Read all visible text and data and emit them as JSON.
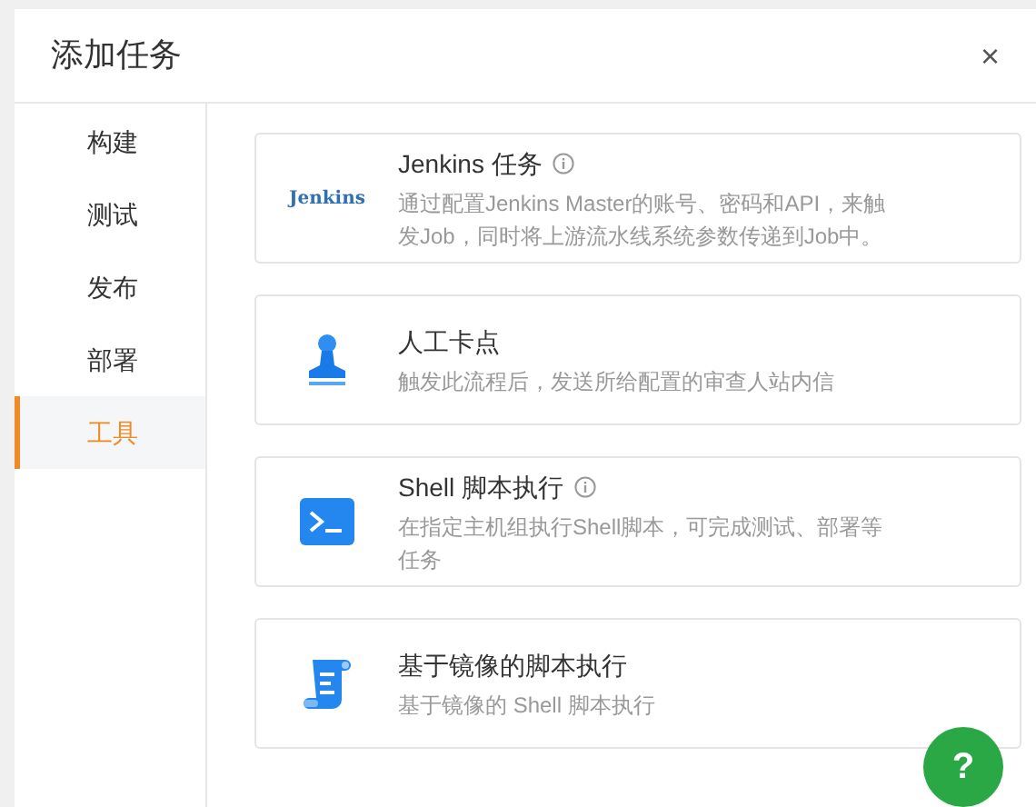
{
  "dialog": {
    "title": "添加任务",
    "close": "×"
  },
  "sidebar": {
    "items": [
      {
        "label": "构建",
        "selected": false
      },
      {
        "label": "测试",
        "selected": false
      },
      {
        "label": "发布",
        "selected": false
      },
      {
        "label": "部署",
        "selected": false
      },
      {
        "label": "工具",
        "selected": true
      }
    ]
  },
  "tasks": [
    {
      "kind": "logo",
      "logo_text": "Jenkins",
      "title": "Jenkins 任务",
      "info": true,
      "description": "通过配置Jenkins Master的账号、密码和API，来触发Job，同时将上游流水线系统参数传递到Job中。"
    },
    {
      "kind": "stamp",
      "title": "人工卡点",
      "info": false,
      "description": "触发此流程后，发送所给配置的审查人站内信"
    },
    {
      "kind": "terminal",
      "title": "Shell 脚本执行",
      "info": true,
      "description": "在指定主机组执行Shell脚本，可完成测试、部署等任务"
    },
    {
      "kind": "scroll",
      "title": "基于镜像的脚本执行",
      "info": false,
      "description": "基于镜像的 Shell 脚本执行"
    }
  ],
  "help_button": "?"
}
